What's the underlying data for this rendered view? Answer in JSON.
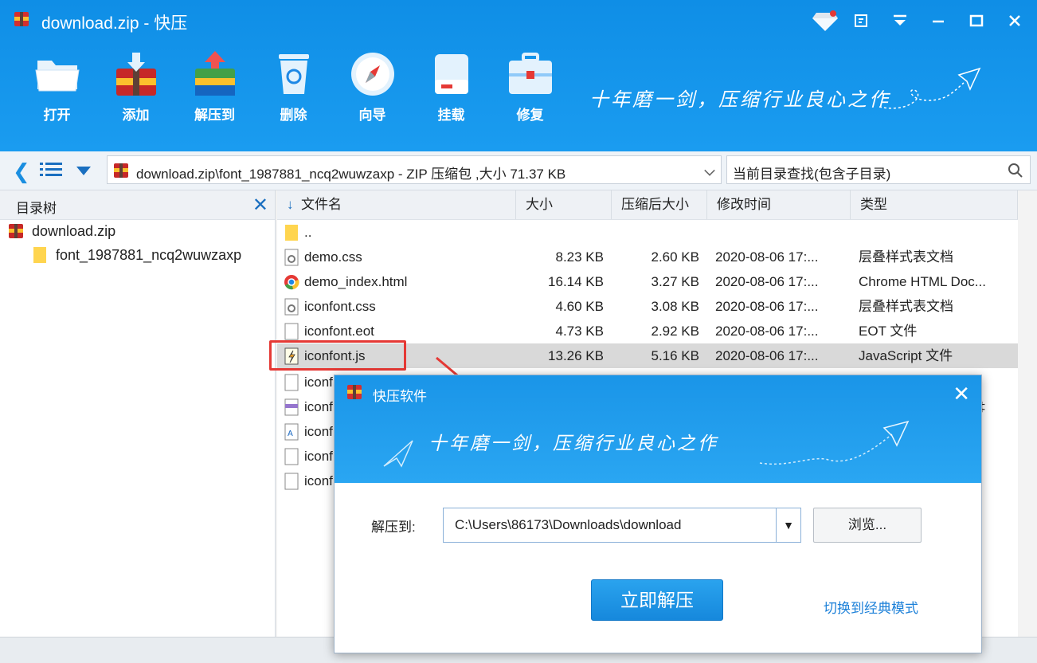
{
  "window": {
    "title": "download.zip - 快压",
    "controls": [
      "gem-icon",
      "feedback-icon",
      "menu-icon",
      "minimize-icon",
      "maximize-icon",
      "close-icon"
    ]
  },
  "toolbar": {
    "items": [
      {
        "label": "打开",
        "icon": "open-folder-icon"
      },
      {
        "label": "添加",
        "icon": "add-archive-icon"
      },
      {
        "label": "解压到",
        "icon": "extract-icon"
      },
      {
        "label": "删除",
        "icon": "recycle-bin-icon"
      },
      {
        "label": "向导",
        "icon": "compass-icon"
      },
      {
        "label": "挂载",
        "icon": "drive-icon"
      },
      {
        "label": "修复",
        "icon": "toolbox-icon"
      }
    ],
    "slogan": "十年磨一剑，压缩行业良心之作"
  },
  "addressbar": {
    "path": "download.zip\\font_1987881_ncq2wuwzaxp - ZIP 压缩包 ,大小 71.37 KB",
    "search_placeholder": "当前目录查找(包含子目录)"
  },
  "tree": {
    "header": "目录树",
    "nodes": [
      {
        "label": "download.zip"
      },
      {
        "label": "font_1987881_ncq2wuwzaxp"
      }
    ]
  },
  "list": {
    "columns": {
      "name": "文件名",
      "size": "大小",
      "packed": "压缩后大小",
      "modified": "修改时间",
      "type": "类型"
    },
    "rows": [
      {
        "name": "..",
        "size": "",
        "packed": "",
        "modified": "",
        "type": "",
        "icon": "folder-icon"
      },
      {
        "name": "demo.css",
        "size": "8.23 KB",
        "packed": "2.60 KB",
        "modified": "2020-08-06    17:...",
        "type": "层叠样式表文档",
        "icon": "css-file-icon"
      },
      {
        "name": "demo_index.html",
        "size": "16.14 KB",
        "packed": "3.27 KB",
        "modified": "2020-08-06    17:...",
        "type": "Chrome HTML Doc...",
        "icon": "chrome-icon"
      },
      {
        "name": "iconfont.css",
        "size": "4.60 KB",
        "packed": "3.08 KB",
        "modified": "2020-08-06    17:...",
        "type": "层叠样式表文档",
        "icon": "css-file-icon"
      },
      {
        "name": "iconfont.eot",
        "size": "4.73 KB",
        "packed": "2.92 KB",
        "modified": "2020-08-06    17:...",
        "type": "EOT 文件",
        "icon": "file-icon"
      },
      {
        "name": "iconfont.js",
        "size": "13.26 KB",
        "packed": "5.16 KB",
        "modified": "2020-08-06    17:...",
        "type": "JavaScript 文件",
        "icon": "js-file-icon"
      },
      {
        "name": "iconf",
        "icon": "file-icon"
      },
      {
        "name": "iconf",
        "icon": "svg-file-icon"
      },
      {
        "name": "iconf",
        "icon": "font-file-icon"
      },
      {
        "name": "iconf",
        "icon": "file-icon"
      },
      {
        "name": "iconf",
        "icon": "file-icon"
      }
    ],
    "partial_type_text": "‡"
  },
  "dialog": {
    "title": "快压软件",
    "slogan": "十年磨一剑，压缩行业良心之作",
    "extract_label": "解压到:",
    "extract_path": "C:\\Users\\86173\\Downloads\\download",
    "browse": "浏览...",
    "extract_now": "立即解压",
    "switch_mode": "切换到经典模式"
  },
  "colors": {
    "accent": "#1a9cf0",
    "annotation": "#e53935"
  }
}
